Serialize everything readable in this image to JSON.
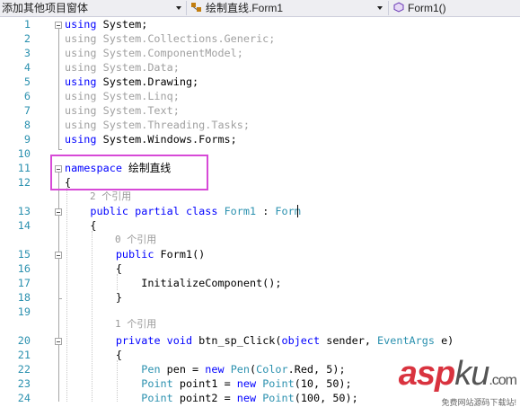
{
  "navbar": {
    "project": "添加其他项目窗体",
    "class": "绘制直线.Form1",
    "member": "Form1()"
  },
  "codelens": {
    "class_refs": "2 个引用",
    "ctor_refs": "0 个引用",
    "method_refs": "1 个引用"
  },
  "lines": [
    {
      "num": "1",
      "segments": [
        {
          "t": "using",
          "c": "kw"
        },
        {
          "t": " System;",
          "c": ""
        }
      ]
    },
    {
      "num": "2",
      "segments": [
        {
          "t": "using System.Collections.Generic;",
          "c": "gray"
        }
      ]
    },
    {
      "num": "3",
      "segments": [
        {
          "t": "using System.ComponentModel;",
          "c": "gray"
        }
      ]
    },
    {
      "num": "4",
      "segments": [
        {
          "t": "using System.Data;",
          "c": "gray"
        }
      ]
    },
    {
      "num": "5",
      "segments": [
        {
          "t": "using",
          "c": "kw"
        },
        {
          "t": " System.Drawing;",
          "c": ""
        }
      ]
    },
    {
      "num": "6",
      "segments": [
        {
          "t": "using System.Linq;",
          "c": "gray"
        }
      ]
    },
    {
      "num": "7",
      "segments": [
        {
          "t": "using System.Text;",
          "c": "gray"
        }
      ]
    },
    {
      "num": "8",
      "segments": [
        {
          "t": "using System.Threading.Tasks;",
          "c": "gray"
        }
      ]
    },
    {
      "num": "9",
      "segments": [
        {
          "t": "using",
          "c": "kw"
        },
        {
          "t": " System.Windows.Forms;",
          "c": ""
        }
      ]
    },
    {
      "num": "10",
      "segments": []
    },
    {
      "num": "11",
      "segments": [
        {
          "t": "namespace",
          "c": "kw"
        },
        {
          "t": " 绘制直线",
          "c": ""
        }
      ]
    },
    {
      "num": "12",
      "segments": [
        {
          "t": "{",
          "c": ""
        }
      ]
    },
    {
      "num": "13",
      "segments": [
        {
          "t": "    ",
          "c": ""
        },
        {
          "t": "public partial class",
          "c": "kw"
        },
        {
          "t": " ",
          "c": ""
        },
        {
          "t": "Form1",
          "c": "ty"
        },
        {
          "t": " : ",
          "c": ""
        },
        {
          "t": "Form",
          "c": "ty"
        }
      ]
    },
    {
      "num": "14",
      "segments": [
        {
          "t": "    {",
          "c": ""
        }
      ]
    },
    {
      "num": "15",
      "segments": [
        {
          "t": "        ",
          "c": ""
        },
        {
          "t": "public",
          "c": "kw"
        },
        {
          "t": " Form1()",
          "c": ""
        }
      ]
    },
    {
      "num": "16",
      "segments": [
        {
          "t": "        {",
          "c": ""
        }
      ]
    },
    {
      "num": "17",
      "segments": [
        {
          "t": "            InitializeComponent();",
          "c": ""
        }
      ]
    },
    {
      "num": "18",
      "segments": [
        {
          "t": "        }",
          "c": ""
        }
      ]
    },
    {
      "num": "19",
      "segments": []
    },
    {
      "num": "20",
      "segments": [
        {
          "t": "        ",
          "c": ""
        },
        {
          "t": "private void",
          "c": "kw"
        },
        {
          "t": " btn_sp_Click(",
          "c": ""
        },
        {
          "t": "object",
          "c": "kw"
        },
        {
          "t": " sender, ",
          "c": ""
        },
        {
          "t": "EventArgs",
          "c": "ty"
        },
        {
          "t": " e)",
          "c": ""
        }
      ]
    },
    {
      "num": "21",
      "segments": [
        {
          "t": "        {",
          "c": ""
        }
      ]
    },
    {
      "num": "22",
      "segments": [
        {
          "t": "            ",
          "c": ""
        },
        {
          "t": "Pen",
          "c": "ty"
        },
        {
          "t": " pen = ",
          "c": ""
        },
        {
          "t": "new",
          "c": "kw"
        },
        {
          "t": " ",
          "c": ""
        },
        {
          "t": "Pen",
          "c": "ty"
        },
        {
          "t": "(",
          "c": ""
        },
        {
          "t": "Color",
          "c": "ty"
        },
        {
          "t": ".Red, 5);",
          "c": ""
        }
      ]
    },
    {
      "num": "23",
      "segments": [
        {
          "t": "            ",
          "c": ""
        },
        {
          "t": "Point",
          "c": "ty"
        },
        {
          "t": " point1 = ",
          "c": ""
        },
        {
          "t": "new",
          "c": "kw"
        },
        {
          "t": " ",
          "c": ""
        },
        {
          "t": "Point",
          "c": "ty"
        },
        {
          "t": "(10, 50);",
          "c": ""
        }
      ]
    },
    {
      "num": "24",
      "segments": [
        {
          "t": "            ",
          "c": ""
        },
        {
          "t": "Point",
          "c": "ty"
        },
        {
          "t": " point2 = ",
          "c": ""
        },
        {
          "t": "new",
          "c": "kw"
        },
        {
          "t": " ",
          "c": ""
        },
        {
          "t": "Point",
          "c": "ty"
        },
        {
          "t": "(100, 50);",
          "c": ""
        }
      ]
    }
  ],
  "watermark": {
    "asp": "asp",
    "ku": "ku",
    "com": ".com",
    "sub": "免费网站源码下载站!"
  }
}
